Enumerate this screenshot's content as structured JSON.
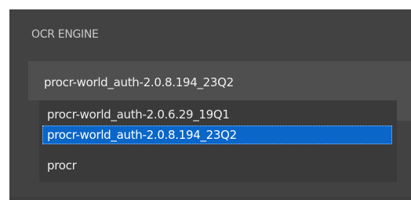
{
  "section": {
    "label": "OCR ENGINE"
  },
  "engine_select": {
    "selected_value": "procr-world_auth-2.0.8.194_23Q2",
    "options": [
      {
        "label": "procr-world_auth-2.0.6.29_19Q1",
        "highlighted": false
      },
      {
        "label": "procr-world_auth-2.0.8.194_23Q2",
        "highlighted": true
      },
      {
        "label": "procr",
        "highlighted": false
      }
    ]
  },
  "colors": {
    "panel_background": "#424242",
    "field_background": "#4f4f4f",
    "dropdown_background": "#3a3a3a",
    "highlight": "#0a66c9",
    "label_text": "#c9c9c9"
  }
}
